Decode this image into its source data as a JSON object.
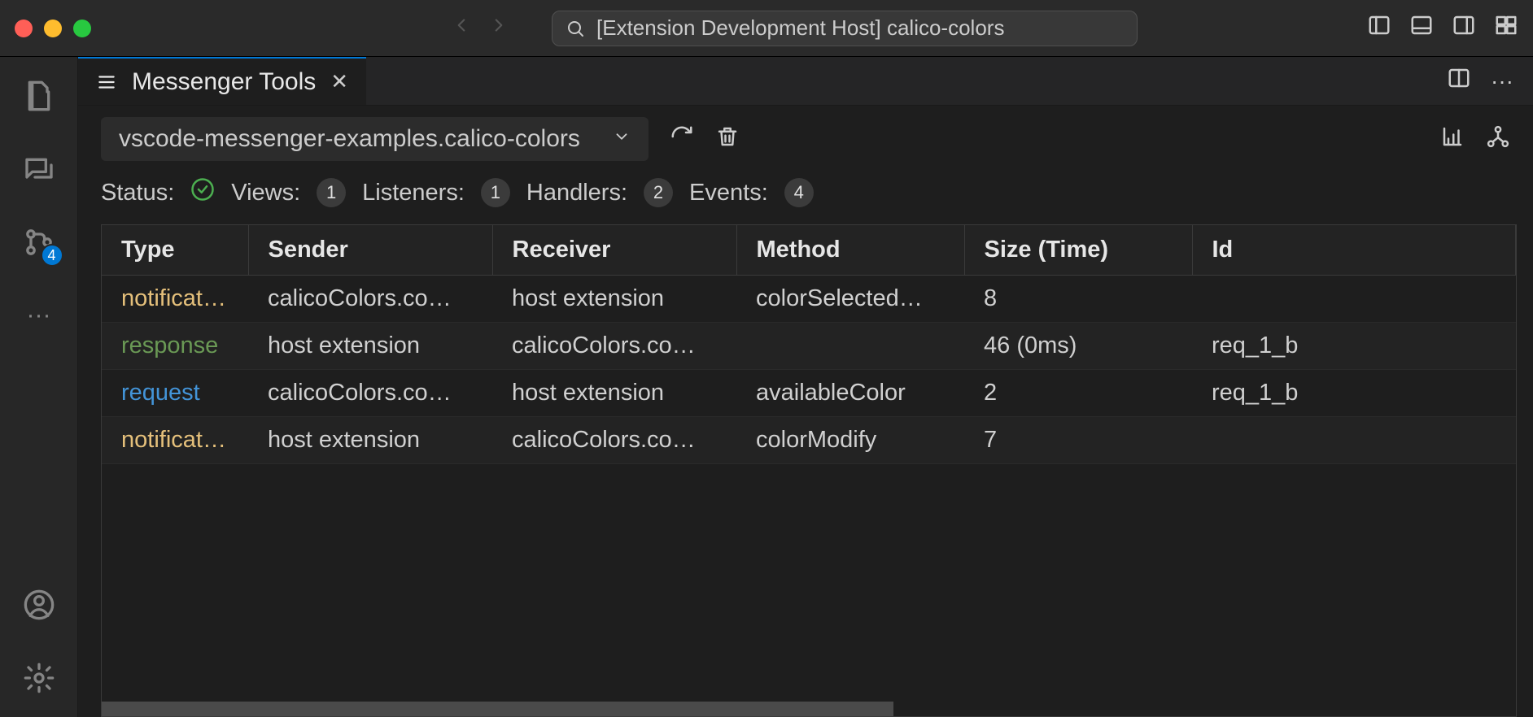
{
  "titlebar": {
    "search_text": "[Extension Development Host] calico-colors"
  },
  "activity": {
    "scm_badge": "4"
  },
  "tab": {
    "title": "Messenger Tools"
  },
  "toolbar": {
    "dropdown_label": "vscode-messenger-examples.calico-colors"
  },
  "status": {
    "status_label": "Status:",
    "views_label": "Views:",
    "views_count": "1",
    "listeners_label": "Listeners:",
    "listeners_count": "1",
    "handlers_label": "Handlers:",
    "handlers_count": "2",
    "events_label": "Events:",
    "events_count": "4"
  },
  "table": {
    "columns": [
      "Type",
      "Sender",
      "Receiver",
      "Method",
      "Size (Time)",
      "Id"
    ],
    "rows": [
      {
        "type": "notification",
        "type_class": "type-notification",
        "sender": "calicoColors.co…",
        "receiver": "host extension",
        "method": "colorSelected…",
        "size": "8",
        "id": ""
      },
      {
        "type": "response",
        "type_class": "type-response",
        "sender": "host extension",
        "receiver": "calicoColors.co…",
        "method": "",
        "size": "46 (0ms)",
        "id": "req_1_b"
      },
      {
        "type": "request",
        "type_class": "type-request",
        "sender": "calicoColors.co…",
        "receiver": "host extension",
        "method": "availableColor",
        "size": "2",
        "id": "req_1_b"
      },
      {
        "type": "notification",
        "type_class": "type-notification",
        "sender": "host extension",
        "receiver": "calicoColors.co…",
        "method": "colorModify",
        "size": "7",
        "id": ""
      }
    ]
  }
}
